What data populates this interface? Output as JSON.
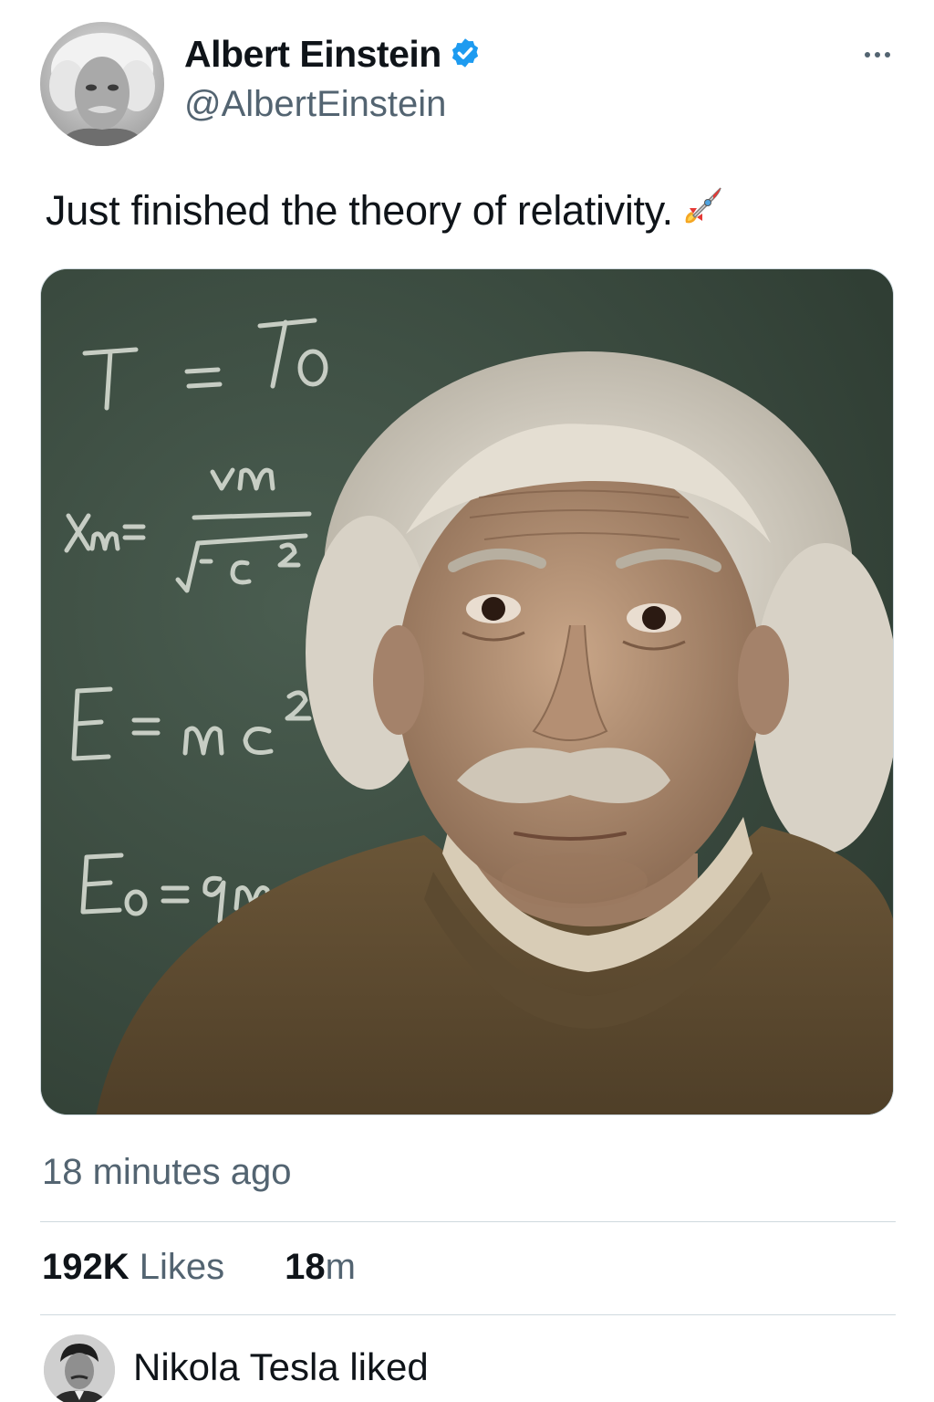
{
  "author": {
    "display_name": "Albert Einstein",
    "handle": "@AlbertEinstein",
    "verified": true,
    "verified_color": "#1d9bf0"
  },
  "tweet": {
    "text": "Just finished the theory of relativity.",
    "emoji_icon": "rocket-icon"
  },
  "media": {
    "chalkboard_lines": [
      "T = To",
      "vm",
      "Xm=",
      "√-c",
      "2",
      "E = mc",
      "2",
      "Eo = 9m"
    ]
  },
  "meta": {
    "timestamp": "18 minutes ago"
  },
  "stats": {
    "likes_count": "192K",
    "likes_label": "Likes",
    "second_value": "18",
    "second_unit": "m"
  },
  "activity": {
    "liker_line": "Nikola Tesla liked"
  },
  "colors": {
    "text_primary": "#0f1419",
    "text_secondary": "#536471",
    "divider": "#cfd9de",
    "chalkboard": "#3f5145"
  }
}
